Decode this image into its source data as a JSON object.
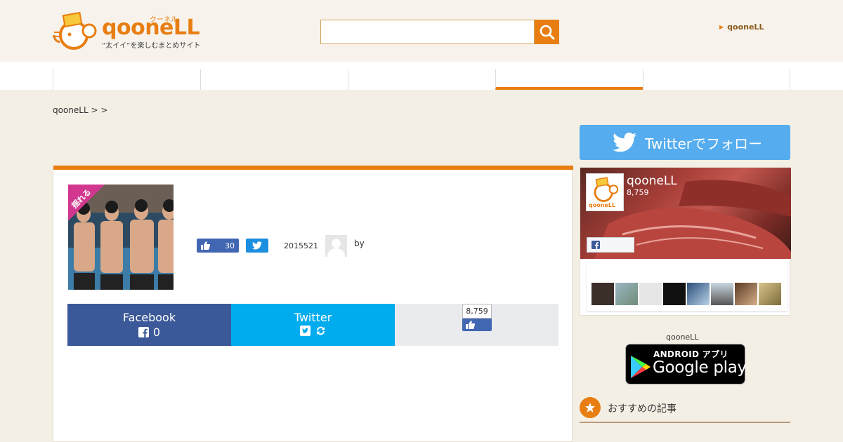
{
  "header": {
    "logo_text": "qooneLL",
    "logo_kana": "クーネル",
    "logo_tagline": "“太イイ”を楽しむまとめサイト",
    "search_placeholder": "",
    "link_label": "qooneLL"
  },
  "nav": {
    "items": [
      "",
      "",
      "",
      "",
      "",
      ""
    ],
    "active_index": 3
  },
  "breadcrumb": "qooneLL >  >",
  "article": {
    "thumb_badge": "揺れる",
    "like_count": "30",
    "date": "2015521",
    "by_label": "by",
    "share": {
      "facebook_label": "Facebook",
      "facebook_count": "0",
      "twitter_label": "Twitter",
      "like_box_count": "8,759"
    }
  },
  "sidebar": {
    "twitter_follow_label": "Twitterでフォロー",
    "fb_page_name": "qooneLL",
    "fb_page_likes": "8,759",
    "fb_logo_text": "qooneLL",
    "app_label": "qooneLL",
    "gplay_small": "ANDROID アプリ",
    "gplay_big": "Google play",
    "recommended_title": "おすすめの記事"
  },
  "colors": {
    "accent": "#e87e12",
    "background": "#f4efe4",
    "facebook": "#3b5998",
    "twitter": "#00aced",
    "twitter_follow": "#55acee"
  }
}
